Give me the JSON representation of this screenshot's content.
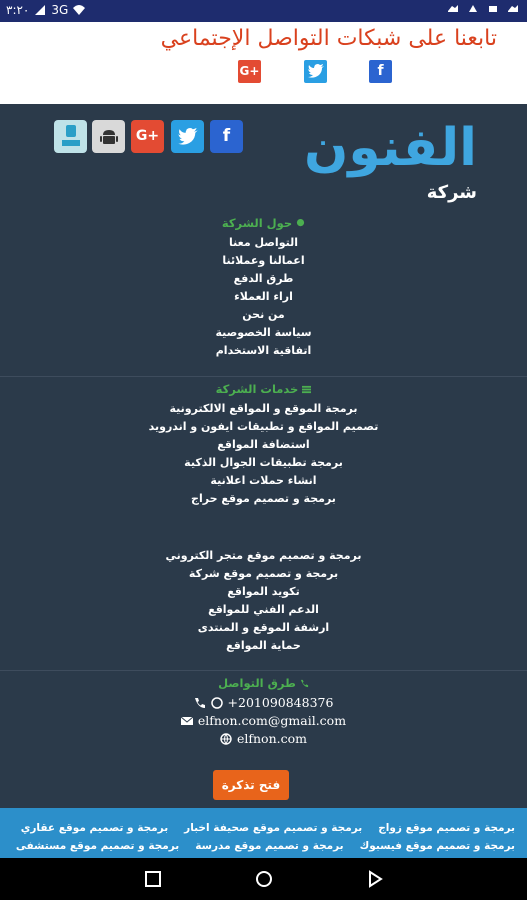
{
  "status_bar": {
    "time": "٣:٢٠",
    "network": "3G"
  },
  "follow": {
    "title": "تابعنا على شبكات التواصل الإجتماعي",
    "icons": [
      "google-plus-icon",
      "twitter-icon",
      "facebook-icon"
    ]
  },
  "logo": {
    "word": "الفنون",
    "sub": "شركة"
  },
  "social_glyphs": {
    "facebook": "f",
    "twitter": "t",
    "google_plus": "G+"
  },
  "about": {
    "title": "حول الشركة",
    "links": [
      "التواصل معنا",
      "اعمالنا وعملائنا",
      "طرق الدفع",
      "اراء العملاء",
      "من نحن",
      "سياسة الخصوصية",
      "اتفاقية الاستخدام"
    ]
  },
  "services": {
    "title": "خدمات الشركة",
    "links": [
      "برمجة الموقع و المواقع الالكترونية",
      "تصميم المواقع و تطبيقات ايفون و اندرويد",
      "استضافة المواقع",
      "برمجة تطبيقات الجوال الذكية",
      "انشاء حملات اعلانية",
      "برمجة و تصميم موقع حراج"
    ],
    "links2": [
      "برمجة و تصميم موقع متجر الكتروني",
      "برمجة و تصميم موقع شركة",
      "تكويد المواقع",
      "الدعم الفني للمواقع",
      "ارشفة الموقع و المنتدى",
      "حماية المواقع"
    ]
  },
  "contact": {
    "title": "طرق التواصل",
    "phone": "+201090848376",
    "email": "elfnon.com@gmail.com",
    "site": "elfnon.com",
    "ticket_label": "فتح تذكرة"
  },
  "strip": {
    "row1": [
      "برمجة و تصميم موقع زواج",
      "برمجة و تصميم موقع صحيفة اخبار",
      "برمجة و تصميم موقع عقاري"
    ],
    "row2": [
      "برمجة و تصميم موقع فيسبوك",
      "برمجة و تصميم موقع مدرسة",
      "برمجة و تصميم موقع مستشفى"
    ]
  },
  "colors": {
    "status_bar": "#1e2c6e",
    "footer_bg": "#2b3a4a",
    "section_title": "#4caf50",
    "follow_title": "#d9411e",
    "ticket_button": "#e8641b",
    "strip_bg": "#2c8fca",
    "logo_blue": "#3fa6e0"
  }
}
